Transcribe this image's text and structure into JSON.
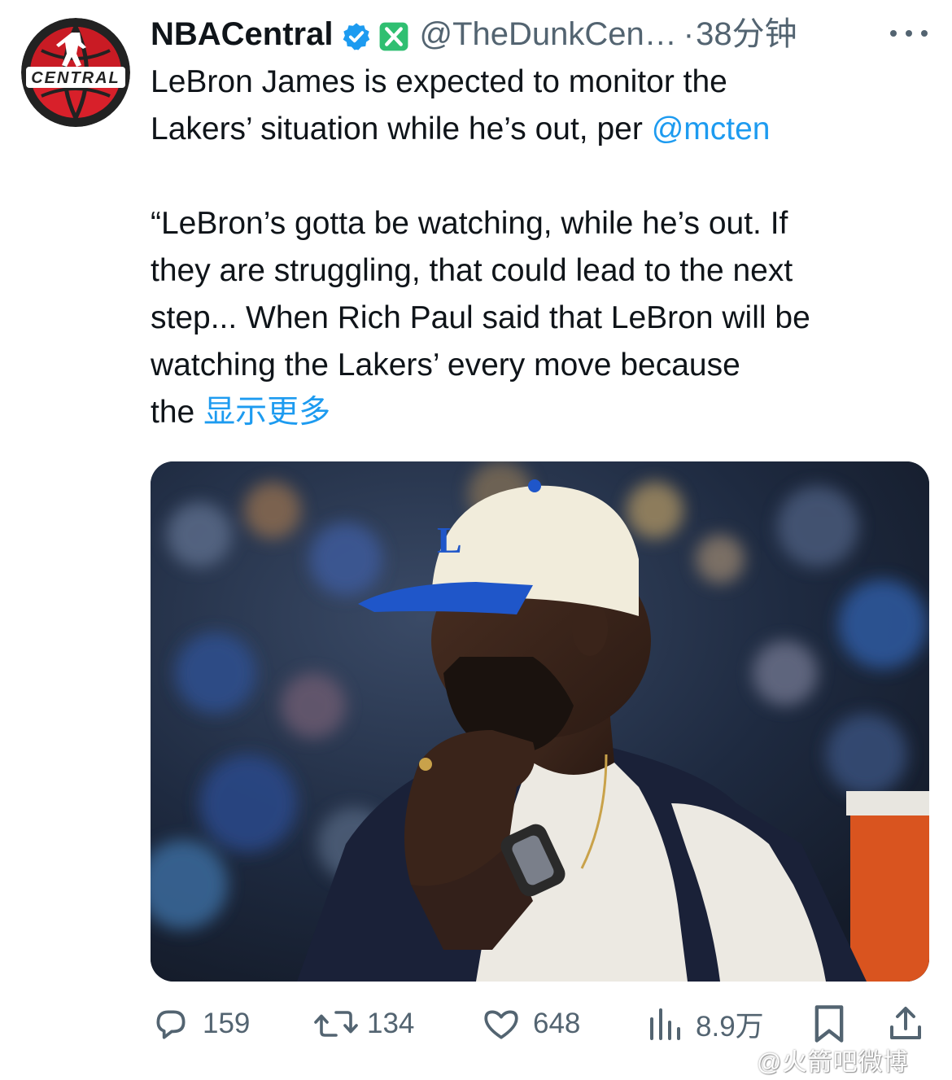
{
  "tweet": {
    "author_name": "NBACentral",
    "handle": "@TheDunkCen…",
    "separator": "·",
    "time": "38分钟",
    "avatar_label": "CENTRAL",
    "text_lines": [
      "LeBron James is expected to monitor the",
      "Lakers’ situation while he’s out, per "
    ],
    "mention": "@mcten",
    "quote_lines": [
      "“LeBron’s gotta be watching, while he’s out. If",
      "they are struggling, that could lead to the next",
      "step... When Rich Paul said that LeBron will be",
      "watching the Lakers’ every move because",
      "the "
    ],
    "show_more": "显示更多"
  },
  "actions": {
    "replies": "159",
    "retweets": "134",
    "likes": "648",
    "views": "8.9万"
  },
  "watermark": "@火箭吧微博",
  "colors": {
    "link": "#1d9bf0",
    "secondary": "#536471",
    "verified": "#1d9bf0",
    "badge": "#2fbf71"
  },
  "icons": [
    "verified-icon",
    "x-badge-icon",
    "more-icon",
    "reply-icon",
    "retweet-icon",
    "like-icon",
    "views-icon",
    "bookmark-icon",
    "share-icon"
  ]
}
